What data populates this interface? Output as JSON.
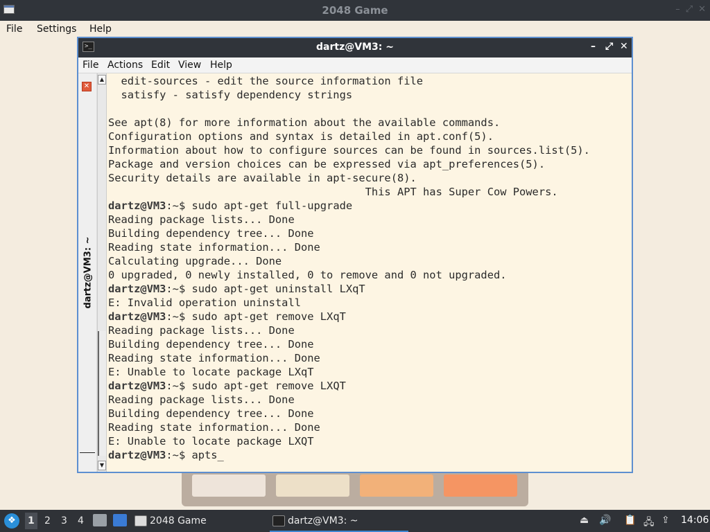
{
  "background_window": {
    "title": "2048 Game",
    "menu": [
      "File",
      "Settings",
      "Help"
    ],
    "tile_colors": [
      "#eee4da",
      "#ede0c8",
      "#f2b179",
      "#f59563"
    ]
  },
  "terminal": {
    "title": "dartz@VM3: ~",
    "menu": [
      "File",
      "Actions",
      "Edit",
      "View",
      "Help"
    ],
    "tab_label": "dartz@VM3: ~",
    "lines": [
      {
        "prompt": "",
        "text": "  edit-sources - edit the source information file"
      },
      {
        "prompt": "",
        "text": "  satisfy - satisfy dependency strings"
      },
      {
        "prompt": "",
        "text": ""
      },
      {
        "prompt": "",
        "text": "See apt(8) for more information about the available commands."
      },
      {
        "prompt": "",
        "text": "Configuration options and syntax is detailed in apt.conf(5)."
      },
      {
        "prompt": "",
        "text": "Information about how to configure sources can be found in sources.list(5)."
      },
      {
        "prompt": "",
        "text": "Package and version choices can be expressed via apt_preferences(5)."
      },
      {
        "prompt": "",
        "text": "Security details are available in apt-secure(8)."
      },
      {
        "prompt": "",
        "text": "                                        This APT has Super Cow Powers."
      },
      {
        "prompt": "dartz@VM3",
        "text": ":~$ sudo apt-get full-upgrade"
      },
      {
        "prompt": "",
        "text": "Reading package lists... Done"
      },
      {
        "prompt": "",
        "text": "Building dependency tree... Done"
      },
      {
        "prompt": "",
        "text": "Reading state information... Done"
      },
      {
        "prompt": "",
        "text": "Calculating upgrade... Done"
      },
      {
        "prompt": "",
        "text": "0 upgraded, 0 newly installed, 0 to remove and 0 not upgraded."
      },
      {
        "prompt": "dartz@VM3",
        "text": ":~$ sudo apt-get uninstall LXqT"
      },
      {
        "prompt": "",
        "text": "E: Invalid operation uninstall"
      },
      {
        "prompt": "dartz@VM3",
        "text": ":~$ sudo apt-get remove LXqT"
      },
      {
        "prompt": "",
        "text": "Reading package lists... Done"
      },
      {
        "prompt": "",
        "text": "Building dependency tree... Done"
      },
      {
        "prompt": "",
        "text": "Reading state information... Done"
      },
      {
        "prompt": "",
        "text": "E: Unable to locate package LXqT"
      },
      {
        "prompt": "dartz@VM3",
        "text": ":~$ sudo apt-get remove LXQT"
      },
      {
        "prompt": "",
        "text": "Reading package lists... Done"
      },
      {
        "prompt": "",
        "text": "Building dependency tree... Done"
      },
      {
        "prompt": "",
        "text": "Reading state information... Done"
      },
      {
        "prompt": "",
        "text": "E: Unable to locate package LXQT"
      },
      {
        "prompt": "dartz@VM3",
        "text": ":~$ apts_"
      }
    ]
  },
  "taskbar": {
    "workspaces": [
      "1",
      "2",
      "3",
      "4"
    ],
    "tasks": [
      {
        "label": "2048 Game",
        "icon": "window-icon"
      },
      {
        "label": "dartz@VM3: ~",
        "icon": "terminal-icon"
      }
    ],
    "clock": "14:06"
  }
}
